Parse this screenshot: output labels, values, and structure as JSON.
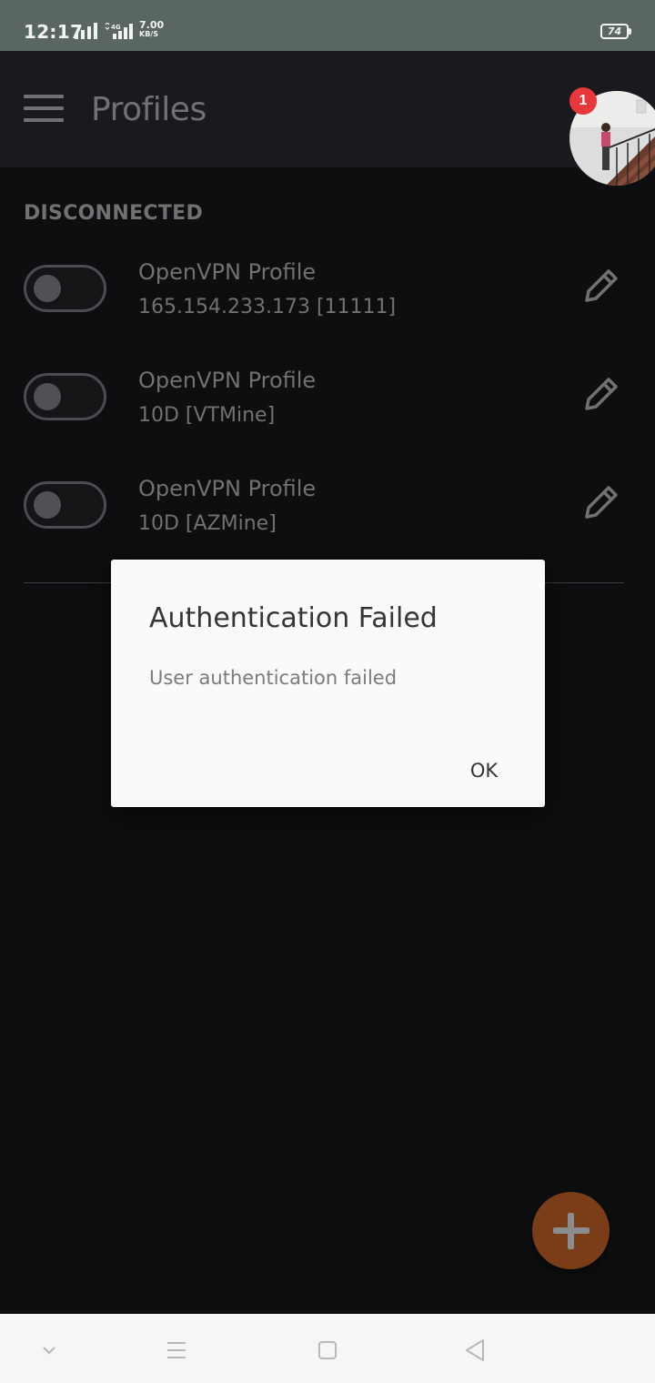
{
  "status_bar": {
    "time": "12:17",
    "network_type": "4G",
    "net_speed_value": "7.00",
    "net_speed_unit": "KB/S",
    "battery": "74"
  },
  "app_bar": {
    "title": "Profiles",
    "notification_count": "1"
  },
  "section": {
    "label": "DISCONNECTED"
  },
  "profiles": [
    {
      "name": "OpenVPN Profile",
      "address": "165.154.233.173 [11111]",
      "connected": false
    },
    {
      "name": "OpenVPN Profile",
      "address": "10D [VTMine]",
      "connected": false
    },
    {
      "name": "OpenVPN Profile",
      "address": "10D [AZMine]",
      "connected": false
    }
  ],
  "dialog": {
    "title": "Authentication Failed",
    "message": "User authentication failed",
    "ok_label": "OK"
  },
  "icons": {
    "menu": "hamburger-menu-icon",
    "edit": "pencil-icon",
    "fab": "plus-icon",
    "nav": [
      "chevron-down-icon",
      "recent-apps-icon",
      "home-icon",
      "back-icon"
    ]
  },
  "colors": {
    "status_bar": "#5a6664",
    "background": "#0d0e10",
    "app_bar": "#181a1d",
    "fab": "#7a3d18",
    "badge": "#e8383b",
    "dialog_bg": "#fafafa"
  }
}
